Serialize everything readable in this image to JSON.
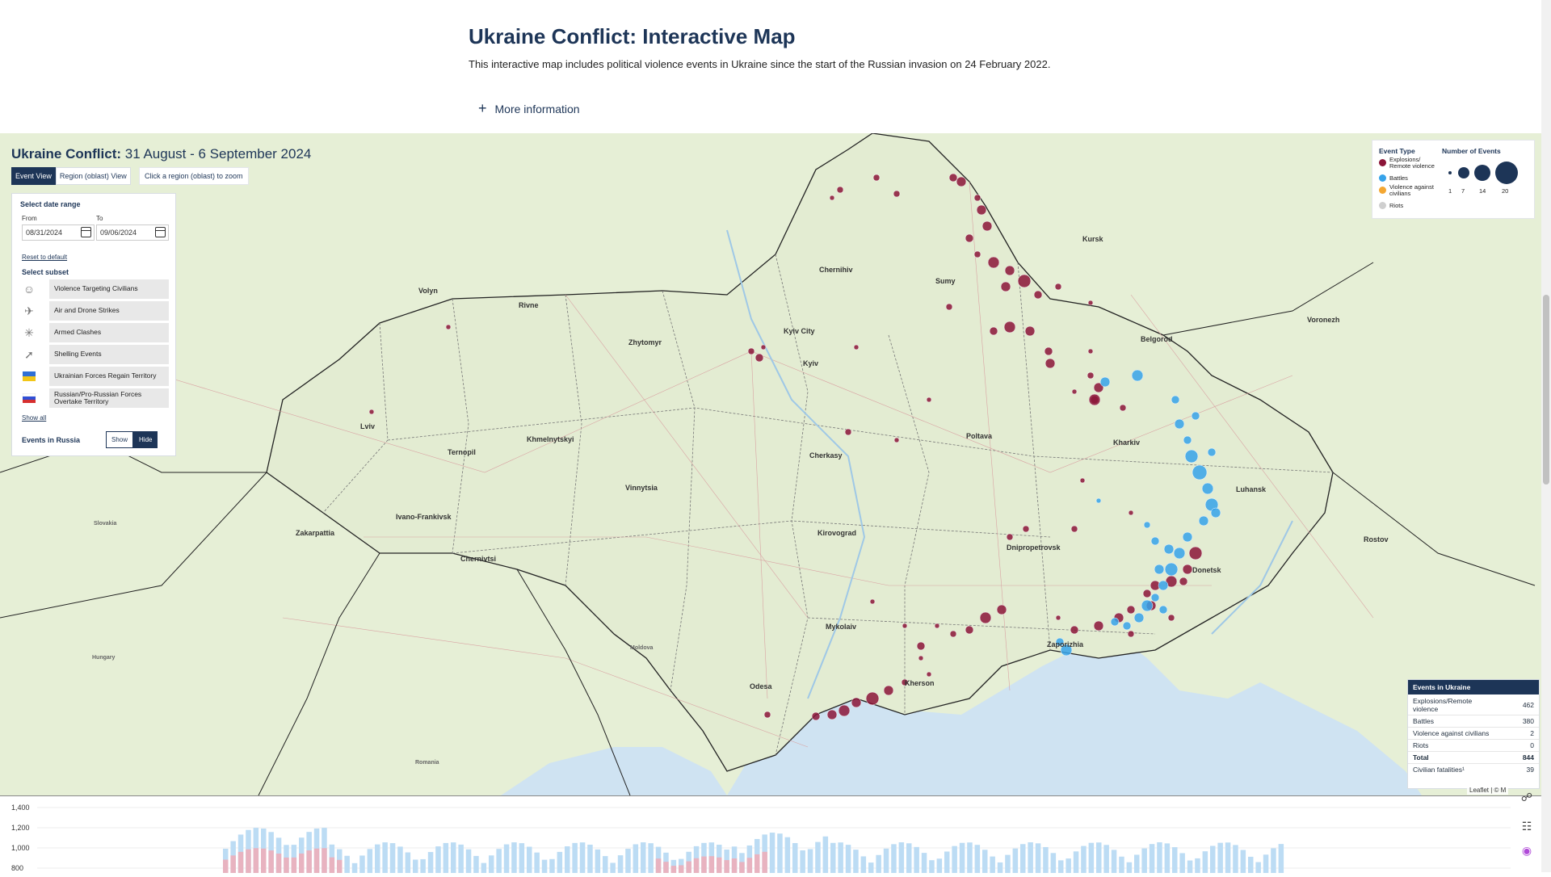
{
  "header": {
    "title": "Ukraine Conflict: Interactive Map",
    "subtitle": "This interactive map includes political violence events in Ukraine since the start of the Russian invasion on 24 February 2022.",
    "more_info": "More information"
  },
  "map": {
    "title_bold": "Ukraine Conflict:",
    "title_range": " 31 August - 6 September 2024",
    "views": [
      "Event View",
      "Region (oblast) View"
    ],
    "active_view": "Event View",
    "zoom_hint": "Click a region (oblast) to zoom",
    "places_major": [
      "Volyn",
      "Rivne",
      "Zhytomyr",
      "Chernihiv",
      "Sumy",
      "Kursk",
      "Belgorod",
      "Voronezh",
      "Kyiv City",
      "Kyiv",
      "Lviv",
      "Ternopil",
      "Khmelnytskyi",
      "Vinnytsia",
      "Cherkasy",
      "Poltava",
      "Kharkiv",
      "Luhansk",
      "Ivano-Frankivsk",
      "Zakarpattia",
      "Chernivtsi",
      "Kirovograd",
      "Dnipropetrovsk",
      "Donetsk",
      "Rostov",
      "Zaporizhia",
      "Mykolaiv",
      "Odesa",
      "Kherson",
      "Moldova",
      "Hungary",
      "Romania",
      "Slovakia"
    ]
  },
  "panel": {
    "date_range_label": "Select date range",
    "from_label": "From",
    "from_value": "08/31/2024",
    "to_label": "To",
    "to_value": "09/06/2024",
    "reset": "Reset to default",
    "subset_label": "Select subset",
    "subsets": [
      {
        "label": "Violence Targeting Civilians",
        "icon": "civilians-icon"
      },
      {
        "label": "Air and Drone Strikes",
        "icon": "airstrike-icon"
      },
      {
        "label": "Armed Clashes",
        "icon": "clash-icon"
      },
      {
        "label": "Shelling Events",
        "icon": "shelling-icon"
      },
      {
        "label": "Ukrainian Forces Regain Territory",
        "icon": "ukraine-flag-icon"
      },
      {
        "label": "Russian/Pro-Russian Forces Overtake Territory",
        "icon": "russia-flag-icon"
      }
    ],
    "show_all": "Show all",
    "events_in_russia": "Events in Russia",
    "russia_show": "Show",
    "russia_hide": "Hide",
    "russia_active": "Hide"
  },
  "legend": {
    "event_type_label": "Event Type",
    "number_label": "Number of Events",
    "types": [
      {
        "label": "Explosions/ Remote violence",
        "color": "#8b1538"
      },
      {
        "label": "Battles",
        "color": "#36a3ea"
      },
      {
        "label": "Violence against civilians",
        "color": "#f4a732"
      },
      {
        "label": "Riots",
        "color": "#cfcfcf"
      }
    ],
    "sizes": [
      "1",
      "7",
      "14",
      "20"
    ]
  },
  "summary": {
    "title": "Events in Ukraine",
    "rows": [
      {
        "label": "Explosions/Remote violence",
        "value": "462"
      },
      {
        "label": "Battles",
        "value": "380"
      },
      {
        "label": "Violence against civilians",
        "value": "2"
      },
      {
        "label": "Riots",
        "value": "0"
      },
      {
        "label": "Total",
        "value": "844"
      },
      {
        "label": "Civilian fatalities¹",
        "value": "39"
      }
    ],
    "attribution": "Leaflet | © M"
  },
  "chart_data": {
    "type": "bar",
    "yticks": [
      "1,400",
      "1,200",
      "1,000",
      "800"
    ],
    "ylim": [
      800,
      1400
    ]
  }
}
